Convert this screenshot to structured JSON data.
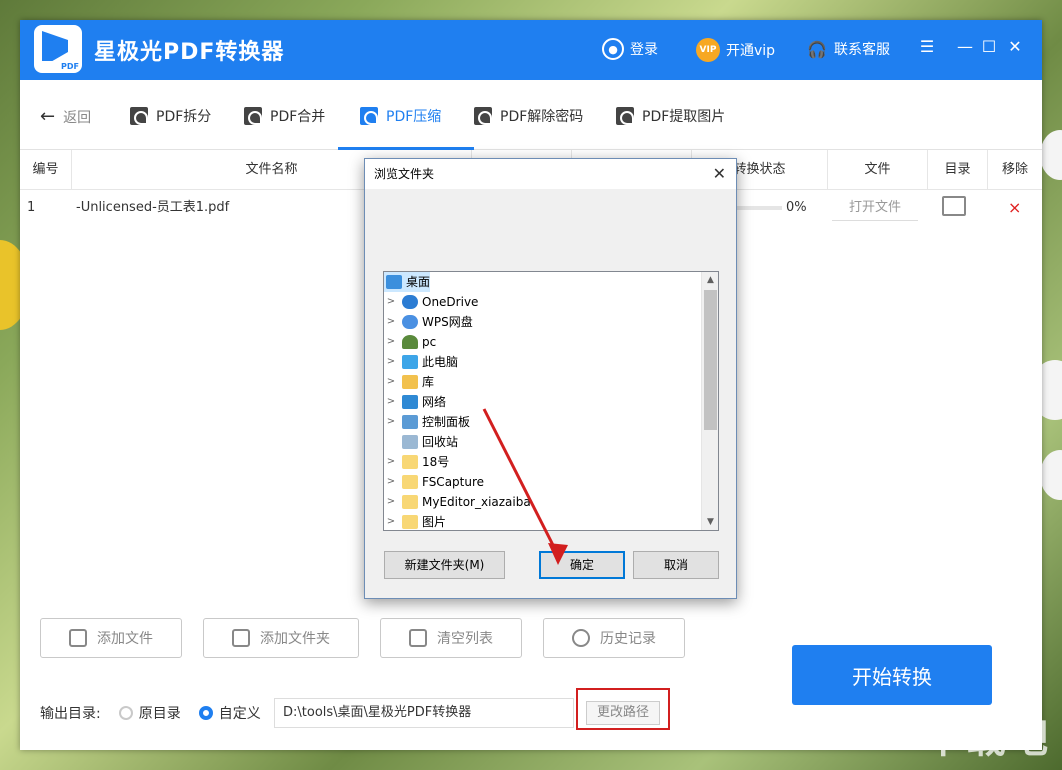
{
  "app": {
    "title": "星极光PDF转换器",
    "logo_tag": "PDF",
    "login": "登录",
    "vip": "开通vip",
    "vip_badge": "VIP",
    "support": "联系客服"
  },
  "tabs": [
    {
      "label": "返回"
    },
    {
      "label": "PDF拆分"
    },
    {
      "label": "PDF合并"
    },
    {
      "label": "PDF压缩"
    },
    {
      "label": "PDF解除密码"
    },
    {
      "label": "PDF提取图片"
    }
  ],
  "table": {
    "headers": [
      "编号",
      "文件名称",
      "转换状态",
      "文件",
      "目录",
      "移除"
    ],
    "rows": [
      {
        "no": "1",
        "name": "-Unlicensed-员工表1.pdf",
        "progress": "0%",
        "open": "打开文件",
        "remove": "×"
      }
    ]
  },
  "actions": {
    "add_file": "添加文件",
    "add_folder": "添加文件夹",
    "clear": "清空列表",
    "history": "历史记录",
    "start": "开始转换"
  },
  "output": {
    "label": "输出目录:",
    "opt_original": "原目录",
    "opt_custom": "自定义",
    "path": "D:\\tools\\桌面\\星极光PDF转换器",
    "change": "更改路径"
  },
  "dialog": {
    "title": "浏览文件夹",
    "tree": [
      {
        "label": "桌面",
        "icon": "desktop-icon",
        "expand": false,
        "selected": true
      },
      {
        "label": "OneDrive",
        "icon": "cloud-icon",
        "expand": true
      },
      {
        "label": "WPS网盘",
        "icon": "cloud-icon",
        "expand": true
      },
      {
        "label": "pc",
        "icon": "user-icon",
        "expand": true
      },
      {
        "label": "此电脑",
        "icon": "computer-icon",
        "expand": true
      },
      {
        "label": "库",
        "icon": "library-icon",
        "expand": true
      },
      {
        "label": "网络",
        "icon": "network-icon",
        "expand": true
      },
      {
        "label": "控制面板",
        "icon": "control-panel-icon",
        "expand": true
      },
      {
        "label": "回收站",
        "icon": "recycle-bin-icon",
        "expand": false
      },
      {
        "label": "18号",
        "icon": "folder-icon",
        "expand": true
      },
      {
        "label": "FSCapture",
        "icon": "folder-icon",
        "expand": true
      },
      {
        "label": "MyEditor_xiazaiba",
        "icon": "folder-icon",
        "expand": true
      },
      {
        "label": "图片",
        "icon": "folder-icon",
        "expand": true
      }
    ],
    "new_folder": "新建文件夹(M)",
    "ok": "确定",
    "cancel": "取消"
  },
  "watermark": "下载吧"
}
